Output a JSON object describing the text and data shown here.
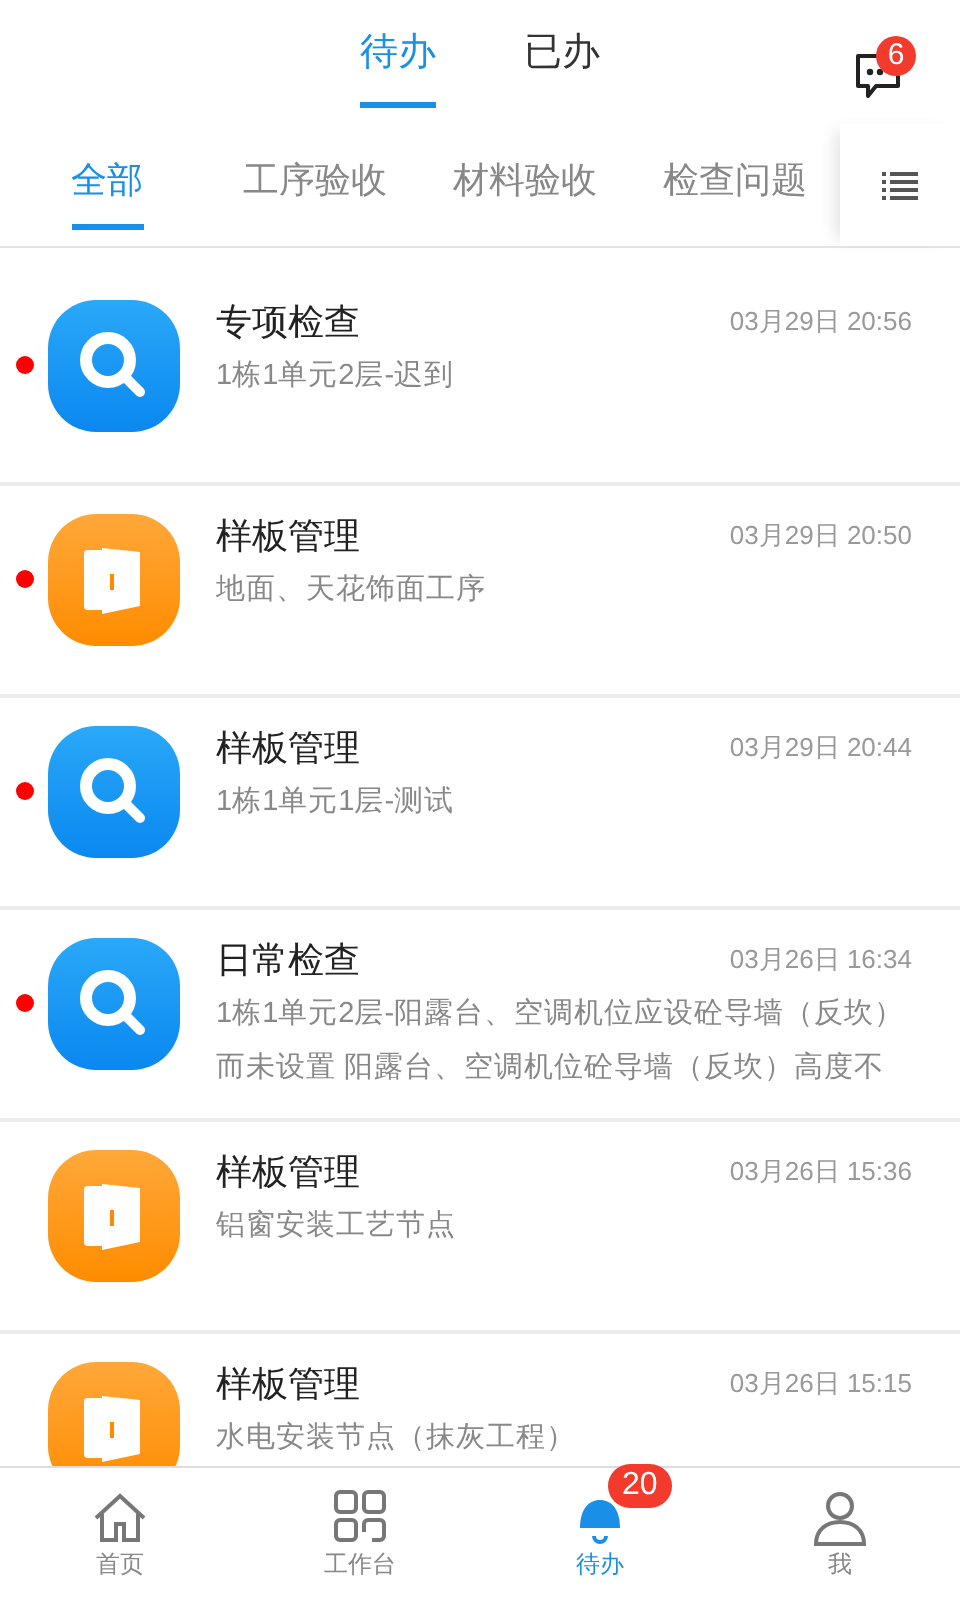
{
  "top_tabs": [
    {
      "label": "待办",
      "selected": true
    },
    {
      "label": "已办",
      "selected": false
    }
  ],
  "message_badge": "6",
  "category_tabs": [
    {
      "label": "全部",
      "selected": true
    },
    {
      "label": "工序验收",
      "selected": false
    },
    {
      "label": "材料验收",
      "selected": false
    },
    {
      "label": "检查问题",
      "selected": false
    }
  ],
  "items": [
    {
      "kind": "inspection",
      "title": "专项检查",
      "time": "03月29日 20:56",
      "lines": [
        "1栋1单元2层-迟到"
      ],
      "unread": true
    },
    {
      "kind": "sample",
      "title": "样板管理",
      "time": "03月29日 20:50",
      "lines": [
        "地面、天花饰面工序"
      ],
      "unread": true
    },
    {
      "kind": "inspection",
      "title": "样板管理",
      "time": "03月29日 20:44",
      "lines": [
        "1栋1单元1层-测试"
      ],
      "unread": true
    },
    {
      "kind": "inspection",
      "title": "日常检查",
      "time": "03月26日 16:34",
      "lines": [
        "1栋1单元2层-阳露台、空调机位应设砼导墙（反坎）",
        "而未设置 阳露台、空调机位砼导墙（反坎）高度不"
      ],
      "unread": true
    },
    {
      "kind": "sample",
      "title": "样板管理",
      "time": "03月26日 15:36",
      "lines": [
        "铝窗安装工艺节点"
      ],
      "unread": false
    },
    {
      "kind": "sample",
      "title": "样板管理",
      "time": "03月26日 15:15",
      "lines": [
        "水电安装节点（抹灰工程）"
      ],
      "unread": false
    }
  ],
  "nav": [
    {
      "kind": "home",
      "label": "首页",
      "selected": false
    },
    {
      "kind": "grid",
      "label": "工作台",
      "selected": false
    },
    {
      "kind": "bell",
      "label": "待办",
      "selected": true,
      "badge": "20"
    },
    {
      "kind": "person",
      "label": "我",
      "selected": false
    }
  ]
}
